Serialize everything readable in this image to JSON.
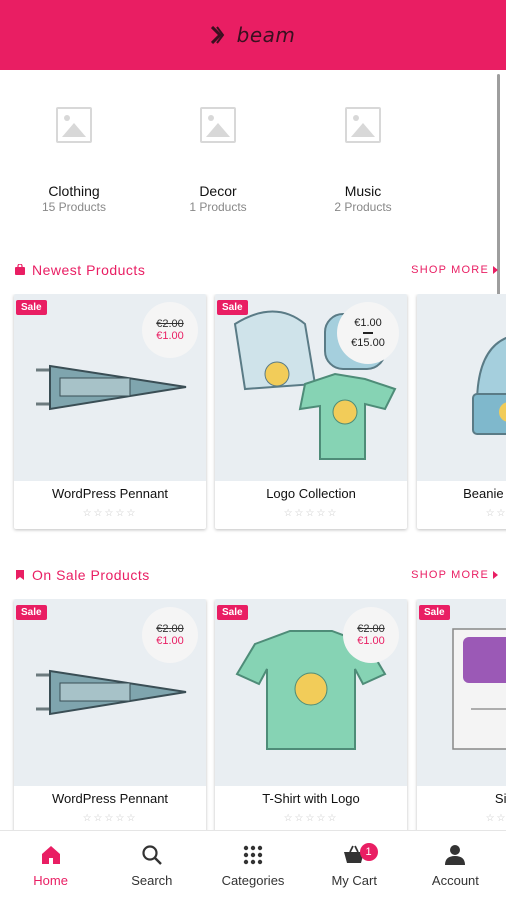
{
  "header": {
    "brand": "beam",
    "color": "#e91e63"
  },
  "categories": [
    {
      "name": "Clothing",
      "count": "15 Products",
      "icon": "image-placeholder-icon"
    },
    {
      "name": "Decor",
      "count": "1 Products",
      "icon": "image-placeholder-icon"
    },
    {
      "name": "Music",
      "count": "2 Products",
      "icon": "image-placeholder-icon"
    }
  ],
  "newest": {
    "title": "Newest Products",
    "shop_more": "SHOP MORE",
    "products": [
      {
        "title": "WordPress Pennant",
        "badge": "Sale",
        "price_old": "€2.00",
        "price_new": "€1.00"
      },
      {
        "title": "Logo Collection",
        "badge": "Sale",
        "price_low": "€1.00",
        "price_high": "€15.00"
      },
      {
        "title": "Beanie with Logo",
        "badge": "",
        "price_old": "",
        "price_new": ""
      }
    ]
  },
  "onsale": {
    "title": "On Sale Products",
    "shop_more": "SHOP MORE",
    "products": [
      {
        "title": "WordPress Pennant",
        "badge": "Sale",
        "price_old": "€2.00",
        "price_new": "€1.00"
      },
      {
        "title": "T-Shirt with Logo",
        "badge": "Sale",
        "price_old": "€2.00",
        "price_new": "€1.00"
      },
      {
        "title": "Single",
        "badge": "Sale",
        "price_old": "",
        "price_new": ""
      }
    ]
  },
  "rating": "☆☆☆☆☆",
  "nav": {
    "items": [
      {
        "label": "Home",
        "icon": "home-icon"
      },
      {
        "label": "Search",
        "icon": "search-icon"
      },
      {
        "label": "Categories",
        "icon": "grid-icon"
      },
      {
        "label": "My Cart",
        "icon": "cart-icon",
        "badge": "1"
      },
      {
        "label": "Account",
        "icon": "account-icon"
      }
    ]
  }
}
